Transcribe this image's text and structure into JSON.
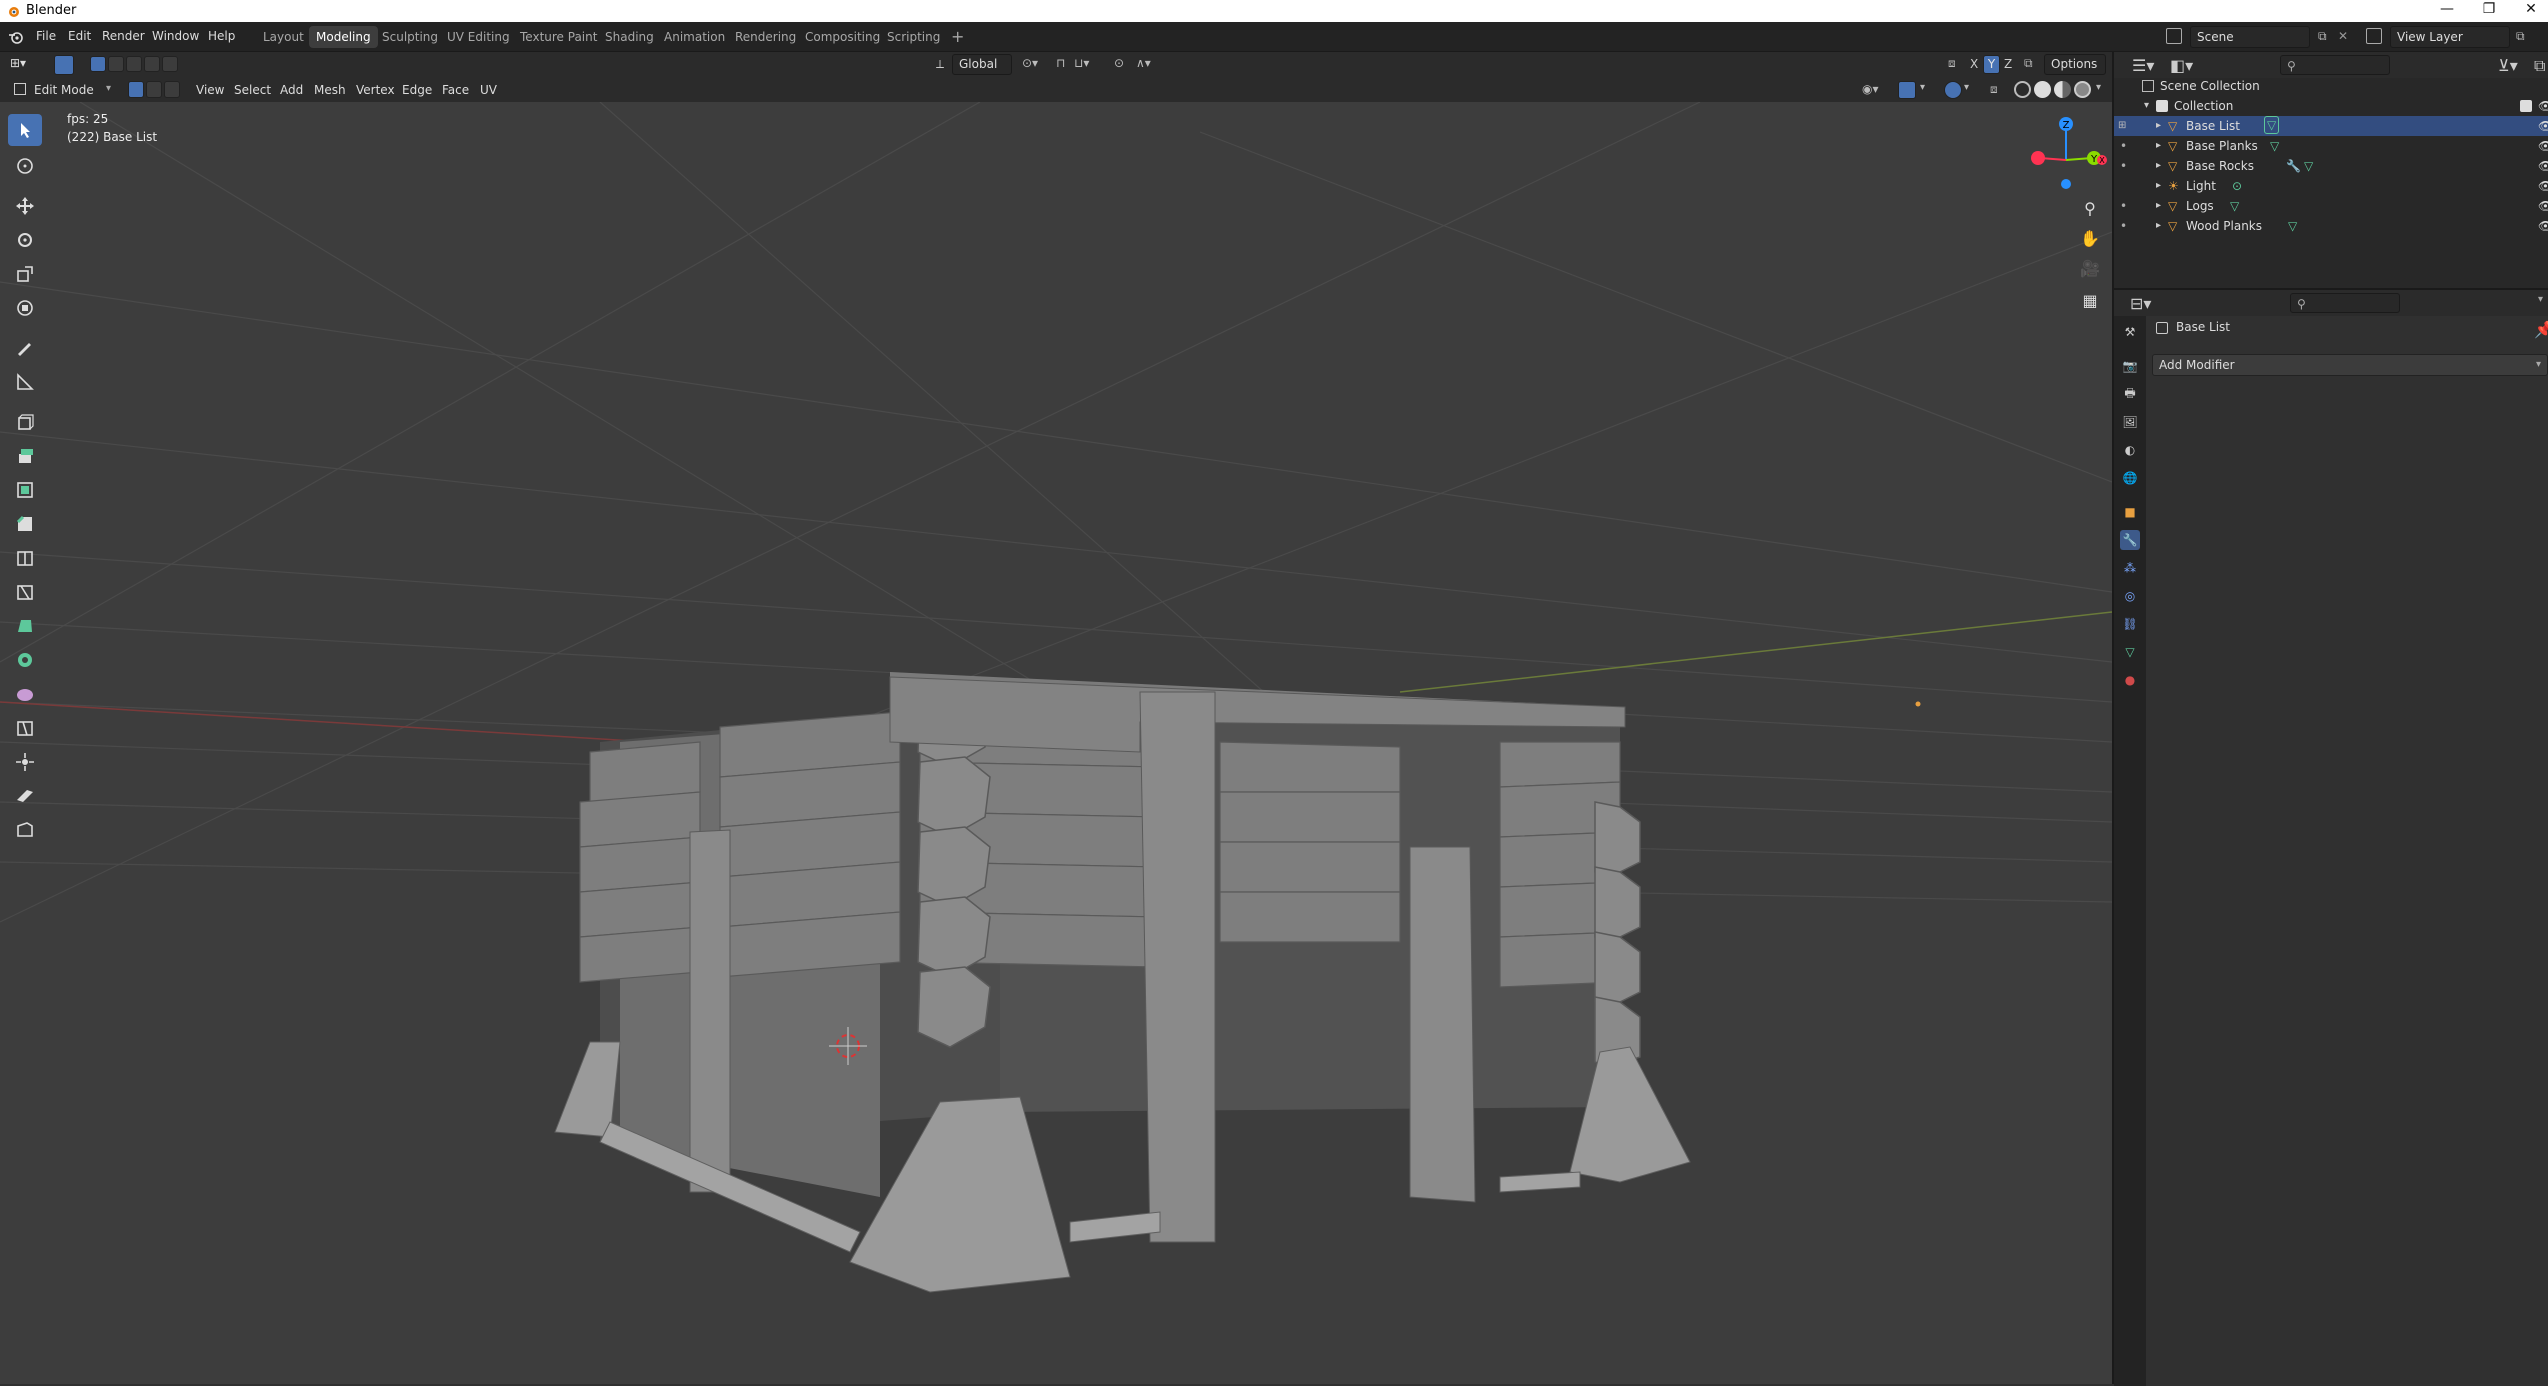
{
  "window": {
    "title": "Blender",
    "controls": [
      "—",
      "❐",
      "✕"
    ]
  },
  "menu": {
    "items": [
      "File",
      "Edit",
      "Render",
      "Window",
      "Help"
    ]
  },
  "workspaces": {
    "tabs": [
      "Layout",
      "Modeling",
      "Sculpting",
      "UV Editing",
      "Texture Paint",
      "Shading",
      "Animation",
      "Rendering",
      "Compositing",
      "Scripting"
    ],
    "active": "Modeling",
    "add": "+"
  },
  "scene": {
    "name": "Scene",
    "view_layer": "View Layer"
  },
  "editor_header": {
    "mode": "Edit Mode",
    "menus": [
      "View",
      "Select",
      "Add",
      "Mesh",
      "Vertex",
      "Edge",
      "Face",
      "UV"
    ],
    "orientation": "Global",
    "options_label": "Options",
    "axes": [
      "X",
      "Y",
      "Z"
    ]
  },
  "viewport": {
    "fps_text": "fps: 25",
    "object_text": "(222) Base List",
    "gizmo": {
      "z": "Z",
      "y": "Y",
      "x": "X"
    }
  },
  "outliner": {
    "root": "Scene Collection",
    "collection": "Collection",
    "items": [
      {
        "name": "Base List",
        "type": "mesh",
        "selected": true
      },
      {
        "name": "Base Planks",
        "type": "mesh"
      },
      {
        "name": "Base Rocks",
        "type": "mesh"
      },
      {
        "name": "Light",
        "type": "light"
      },
      {
        "name": "Logs",
        "type": "mesh"
      },
      {
        "name": "Wood Planks",
        "type": "mesh"
      }
    ]
  },
  "properties": {
    "object_name": "Base List",
    "add_modifier": "Add Modifier",
    "tab_icons": [
      "tool-icon",
      "render-icon",
      "output-icon",
      "view-layer-icon",
      "scene-icon",
      "world-icon",
      "object-icon",
      "modifier-icon",
      "particles-icon",
      "physics-icon",
      "constraints-icon",
      "data-icon",
      "material-icon"
    ],
    "active_tab": "modifier-icon"
  },
  "colors": {
    "accent": "#4772b3",
    "mesh": "#e8a040",
    "data": "#5dc89b",
    "red": "#ff3352",
    "green": "#8bdc00",
    "blue": "#2890ff"
  }
}
